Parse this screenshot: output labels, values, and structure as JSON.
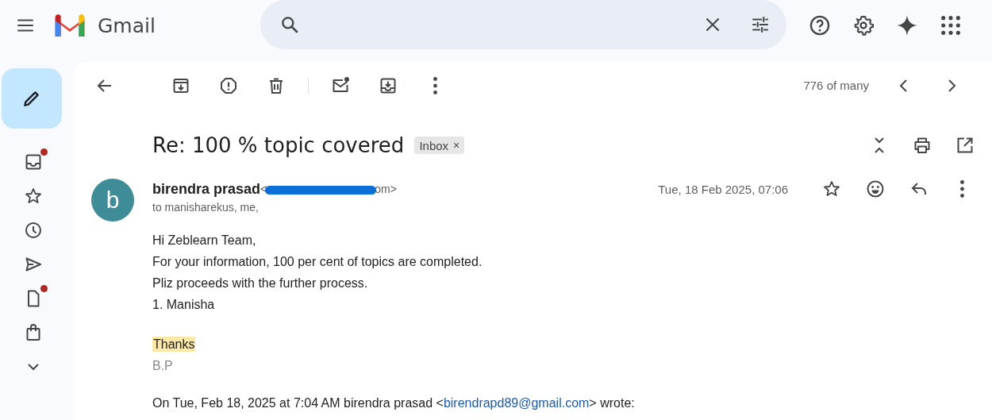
{
  "topbar": {
    "app_name": "Gmail"
  },
  "sidebar": {
    "items": [
      {
        "kind": "inbox",
        "unread": true
      },
      {
        "kind": "starred",
        "unread": false
      },
      {
        "kind": "snoozed",
        "unread": false
      },
      {
        "kind": "sent",
        "unread": false
      },
      {
        "kind": "drafts",
        "unread": true
      },
      {
        "kind": "purchases",
        "unread": false
      },
      {
        "kind": "more",
        "unread": false
      }
    ]
  },
  "toolbar": {
    "counter": "776 of many"
  },
  "message": {
    "subject": "Re: 100 % topic covered",
    "label": "Inbox",
    "label_remove": "×",
    "avatar_letter": "b",
    "sender_name": "birendra prasad",
    "email_start": "<",
    "email_end": "om>",
    "recipients": "to manisharekus, me,",
    "date": "Tue, 18 Feb 2025, 07:06",
    "body": [
      "Hi Zeblearn Team,",
      "For your information, 100 per cent of topics are completed.",
      "Pliz proceeds with the further process.",
      "1. Manisha"
    ],
    "closing": {
      "text": "Thanks",
      "highlighted": true
    },
    "signature": "B.P",
    "quote": {
      "prefix": "On Tue, Feb 18, 2025 at 7:04 AM birendra prasad <",
      "link": "birendrapd89@gmail.com",
      "suffix": "> wrote:"
    }
  }
}
